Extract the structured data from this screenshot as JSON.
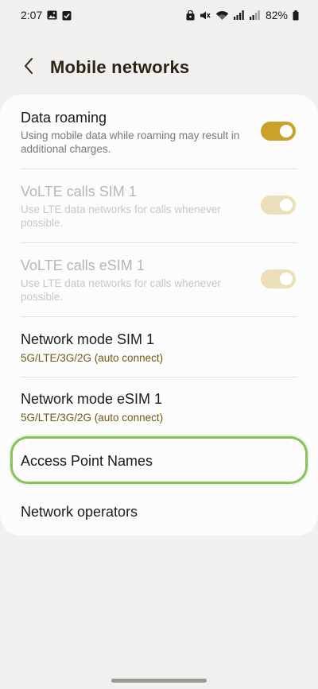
{
  "status_bar": {
    "time": "2:07",
    "battery": "82%",
    "icons_left": [
      "gallery-icon",
      "checkbox-icon"
    ],
    "icons_right": [
      "lock-icon",
      "mute-icon",
      "wifi-icon",
      "signal-icon",
      "signal-icon-2",
      "battery-icon"
    ]
  },
  "header": {
    "title": "Mobile networks"
  },
  "settings": {
    "data_roaming": {
      "title": "Data roaming",
      "description": "Using mobile data while roaming may result in additional charges.",
      "enabled": true
    },
    "volte_sim1": {
      "title": "VoLTE calls SIM 1",
      "description": "Use LTE data networks for calls whenever possible.",
      "enabled": true,
      "disabled": true
    },
    "volte_esim1": {
      "title": "VoLTE calls eSIM 1",
      "description": "Use LTE data networks for calls whenever possible.",
      "enabled": true,
      "disabled": true
    },
    "network_mode_sim1": {
      "title": "Network mode SIM 1",
      "value": "5G/LTE/3G/2G (auto connect)"
    },
    "network_mode_esim1": {
      "title": "Network mode eSIM 1",
      "value": "5G/LTE/3G/2G (auto connect)"
    },
    "access_point_names": {
      "title": "Access Point Names"
    },
    "network_operators": {
      "title": "Network operators"
    }
  },
  "colors": {
    "accent": "#c9a227",
    "highlight": "#86c35b",
    "background": "#f1f0ee"
  }
}
